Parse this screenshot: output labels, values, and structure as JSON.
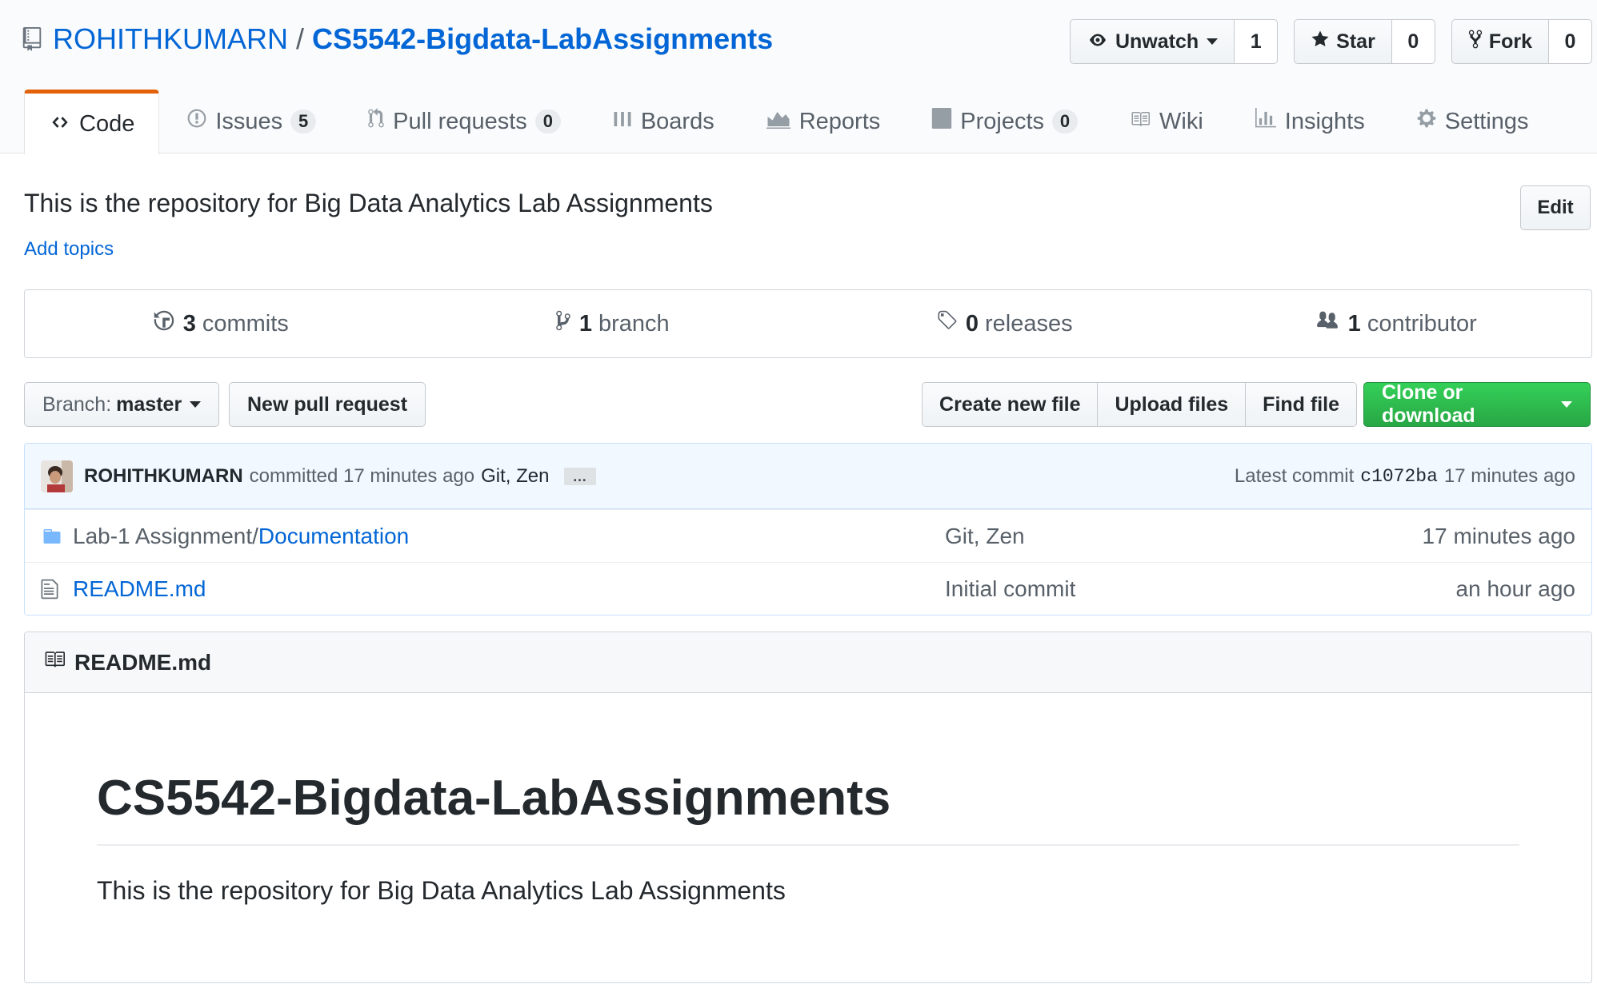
{
  "repo": {
    "owner": "ROHITHKUMARN",
    "separator": "/",
    "name": "CS5542-Bigdata-LabAssignments"
  },
  "actions": {
    "watch": {
      "label": "Unwatch",
      "count": "1"
    },
    "star": {
      "label": "Star",
      "count": "0"
    },
    "fork": {
      "label": "Fork",
      "count": "0"
    }
  },
  "tabs": [
    {
      "label": "Code",
      "icon": "code-icon",
      "selected": true
    },
    {
      "label": "Issues",
      "icon": "issue-icon",
      "count": "5"
    },
    {
      "label": "Pull requests",
      "icon": "pull-request-icon",
      "count": "0"
    },
    {
      "label": "Boards",
      "icon": "boards-icon"
    },
    {
      "label": "Reports",
      "icon": "graph-icon"
    },
    {
      "label": "Projects",
      "icon": "project-icon",
      "count": "0"
    },
    {
      "label": "Wiki",
      "icon": "book-icon"
    },
    {
      "label": "Insights",
      "icon": "graph-bar-icon"
    },
    {
      "label": "Settings",
      "icon": "gear-icon"
    }
  ],
  "description": "This is the repository for Big Data Analytics Lab Assignments",
  "add_topics": "Add topics",
  "edit_label": "Edit",
  "summary": {
    "commits": {
      "num": "3",
      "label": "commits"
    },
    "branch": {
      "num": "1",
      "label": "branch"
    },
    "releases": {
      "num": "0",
      "label": "releases"
    },
    "contributors": {
      "num": "1",
      "label": "contributor"
    }
  },
  "file_nav": {
    "branch_prefix": "Branch:",
    "branch_name": "master",
    "new_pr": "New pull request",
    "create_file": "Create new file",
    "upload_files": "Upload files",
    "find_file": "Find file",
    "clone": "Clone or download"
  },
  "commit": {
    "author": "ROHITHKUMARN",
    "action": "committed 17 minutes ago",
    "message": "Git, Zen",
    "ellipsis": "…",
    "latest_label": "Latest commit",
    "sha": "c1072ba",
    "age": "17 minutes ago"
  },
  "files": [
    {
      "type": "directory",
      "icon": "folder-icon",
      "prefix": "Lab-1 Assignment/",
      "link": "Documentation",
      "message": "Git, Zen",
      "age": "17 minutes ago"
    },
    {
      "type": "file",
      "icon": "file-icon",
      "prefix": "",
      "link": "README.md",
      "message": "Initial commit",
      "age": "an hour ago"
    }
  ],
  "readme": {
    "filename": "README.md",
    "heading": "CS5542-Bigdata-LabAssignments",
    "body": "This is the repository for Big Data Analytics Lab Assignments"
  },
  "colors": {
    "link": "#0366d6",
    "selected_tab_accent": "#e36209",
    "clone_green": "#28a745",
    "commit_bar_bg": "#f1f8ff"
  }
}
